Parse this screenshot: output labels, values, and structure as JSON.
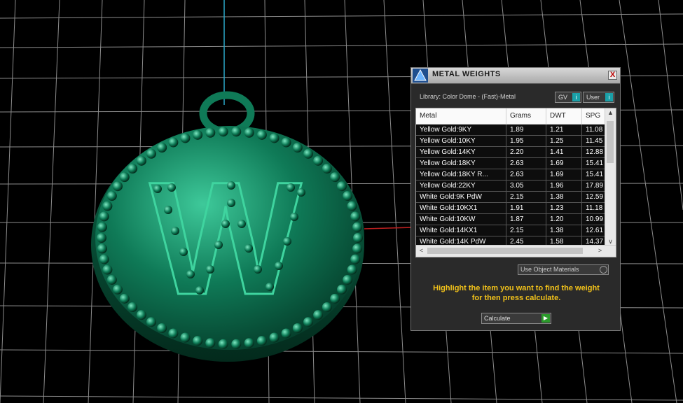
{
  "panel": {
    "title": "METAL WEIGHTS",
    "close_label": "X",
    "library_label": "Library: Color Dome - (Fast)-Metal",
    "gv_label": "GV",
    "user_label": "User",
    "columns": [
      "Metal",
      "Grams",
      "DWT",
      "SPG"
    ],
    "rows": [
      {
        "metal": "Yellow Gold:9KY",
        "grams": "1.89",
        "dwt": "1.21",
        "spg": "11.08"
      },
      {
        "metal": "Yellow Gold:10KY",
        "grams": "1.95",
        "dwt": "1.25",
        "spg": "11.45"
      },
      {
        "metal": "Yellow Gold:14KY",
        "grams": "2.20",
        "dwt": "1.41",
        "spg": "12.88"
      },
      {
        "metal": "Yellow Gold:18KY",
        "grams": "2.63",
        "dwt": "1.69",
        "spg": "15.41"
      },
      {
        "metal": "Yellow Gold:18KY R...",
        "grams": "2.63",
        "dwt": "1.69",
        "spg": "15.41"
      },
      {
        "metal": "Yellow Gold:22KY",
        "grams": "3.05",
        "dwt": "1.96",
        "spg": "17.89"
      },
      {
        "metal": "White Gold:9K PdW",
        "grams": "2.15",
        "dwt": "1.38",
        "spg": "12.59"
      },
      {
        "metal": "White Gold:10KX1",
        "grams": "1.91",
        "dwt": "1.23",
        "spg": "11.18"
      },
      {
        "metal": "White Gold:10KW",
        "grams": "1.87",
        "dwt": "1.20",
        "spg": "10.99"
      },
      {
        "metal": "White Gold:14KX1",
        "grams": "2.15",
        "dwt": "1.38",
        "spg": "12.61"
      },
      {
        "metal": "White Gold:14K PdW",
        "grams": "2.45",
        "dwt": "1.58",
        "spg": "14.37"
      }
    ],
    "use_object_materials_label": "Use Object Materials",
    "hint_line1": "Highlight the item you want to find the weight",
    "hint_line2": "for then press calculate.",
    "calculate_label": "Calculate"
  },
  "viewport": {
    "pendant_letter": "W",
    "pendant_color": "#0f7a57",
    "grid_color": "#8c8c8c",
    "axis_y_color": "#2aa7c9",
    "axis_x_color": "#c02020"
  }
}
